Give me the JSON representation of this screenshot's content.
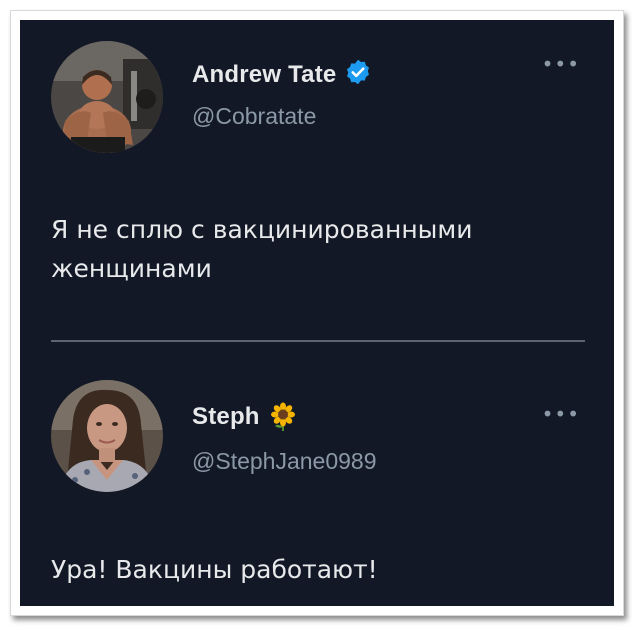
{
  "tweets": [
    {
      "display_name": "Andrew Tate",
      "verified": true,
      "handle": "@Cobratate",
      "more_label": "•••",
      "text": "Я не сплю с вакцинированными женщинами",
      "avatar_icon": "profile-photo-man"
    },
    {
      "display_name": "Steph",
      "emoji": "sunflower-icon",
      "handle": "@StephJane0989",
      "more_label": "•••",
      "text": "Ура! Вакцины работают!",
      "avatar_icon": "profile-photo-woman"
    }
  ],
  "colors": {
    "background": "#131826",
    "text": "#e7e9ea",
    "muted": "#8b98a5",
    "verified": "#1d9bf0"
  }
}
